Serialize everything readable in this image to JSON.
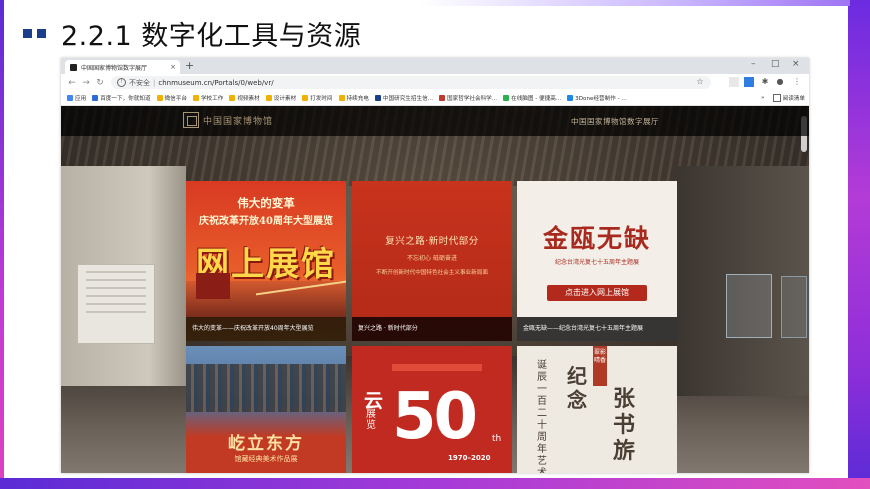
{
  "slide": {
    "title": "2.2.1 数字化工具与资源"
  },
  "browser": {
    "tab_title": "中国国家博物馆数字展厅",
    "new_tab": "+",
    "security_label": "不安全",
    "url": "chnmuseum.cn/Portals/0/web/vr/",
    "bookmarks": [
      {
        "label": "应用",
        "color": "#4285f4"
      },
      {
        "label": "百度一下，你就知道",
        "color": "#2d6bd6"
      },
      {
        "label": "微信平台",
        "color": "#f2b100"
      },
      {
        "label": "学校工作",
        "color": "#f2b100"
      },
      {
        "label": "视频素材",
        "color": "#f2b100"
      },
      {
        "label": "设计素材",
        "color": "#f2b100"
      },
      {
        "label": "打发时间",
        "color": "#f2b100"
      },
      {
        "label": "持续充电",
        "color": "#f2b100"
      },
      {
        "label": "中国研究生招生信...",
        "color": "#1a3f8a"
      },
      {
        "label": "国家哲学社会科学...",
        "color": "#c0392b"
      },
      {
        "label": "在线脑图 - 便捷高...",
        "color": "#2bb24c"
      },
      {
        "label": "3Done经营制作 - ...",
        "color": "#1e88e5"
      }
    ],
    "bookmarks_more": "»",
    "reading_list": "阅读清单"
  },
  "page": {
    "logo_text": "中国国家博物馆",
    "header_subtitle": "中国国家博物馆数字展厅",
    "cards": [
      {
        "caption": "伟大的变革——庆祝改革开放40周年大型展览",
        "poster_line1": "伟大的变革",
        "poster_line2": "庆祝改革开放40周年大型展览",
        "poster_big": "网上展馆"
      },
      {
        "caption": "复兴之路 · 新时代部分",
        "poster_line1": "复兴之路·新时代部分",
        "poster_line2": "不忘初心  砥砺奋进",
        "poster_line3": "不断开创新时代中国特色社会主义事业新局面"
      },
      {
        "caption": "金瓯无缺——纪念台湾光复七十五周年主题展",
        "poster_big": "金瓯无缺",
        "poster_sub": "纪念台湾光复七十五周年主题展",
        "poster_button": "点击进入网上展馆"
      },
      {
        "poster_big": "屹立东方",
        "poster_sub": "馆藏经典美术作品展"
      },
      {
        "poster_yun": "云",
        "poster_zhan": "展览",
        "poster_50": "50",
        "poster_th": "th",
        "poster_years": "1970–2020"
      },
      {
        "poster_col1": "诞辰一百二十周年艺术",
        "poster_col2": "纪念",
        "poster_col3": "张书旂",
        "poster_badge": "翠影晴香"
      }
    ]
  },
  "colors": {
    "accent_purple": "#5a2bd6",
    "accent_pink": "#e24fbf",
    "title_bullet": "#1a3f8a"
  }
}
